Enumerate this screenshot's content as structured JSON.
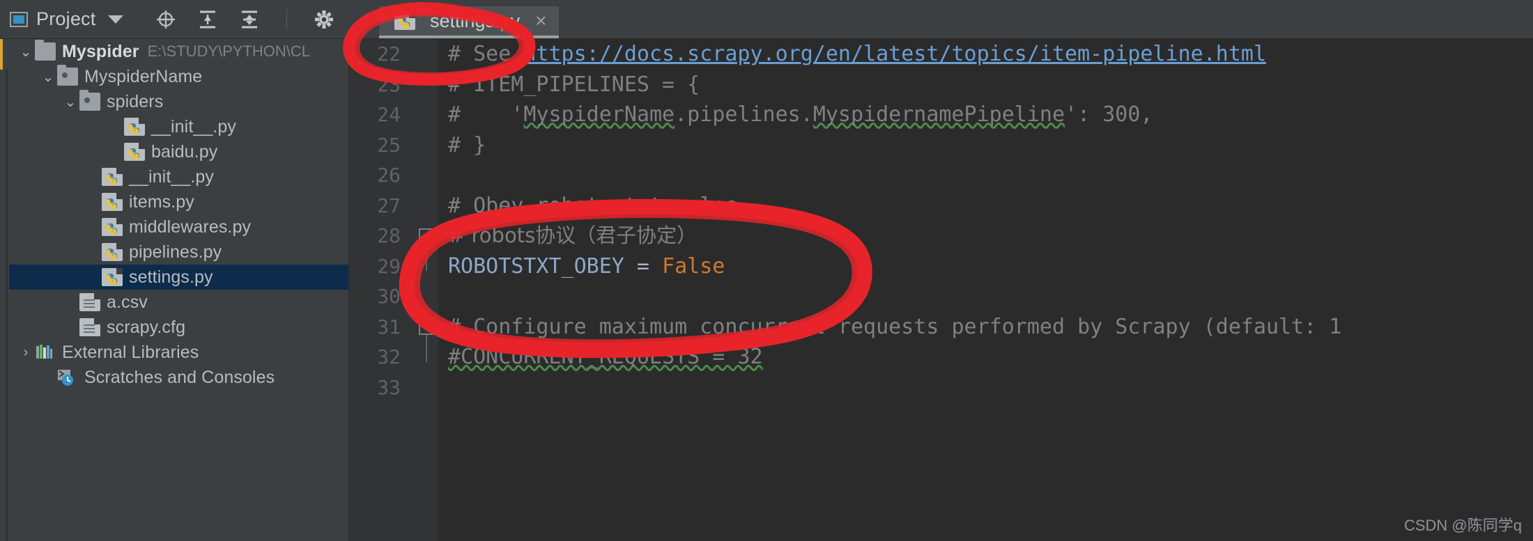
{
  "toolwindow": {
    "title": "Project",
    "icons": [
      {
        "name": "locate-icon",
        "glyph": "⊕"
      },
      {
        "name": "expand-all-icon",
        "glyph": "⇳"
      },
      {
        "name": "collapse-all-icon",
        "glyph": "⇲"
      },
      {
        "name": "settings-gear-icon",
        "glyph": "⚙"
      }
    ],
    "dropdown_caret": "▾"
  },
  "editor_tabs": [
    {
      "label": "settings.py",
      "icon": "python-file-icon",
      "close": "×",
      "active": true
    }
  ],
  "project_tree": [
    {
      "label": "Myspider",
      "path": "E:\\STUDY\\PYTHON\\CL",
      "icon": "folder-icon",
      "chevron": "⌄",
      "depth": 0,
      "bold": true,
      "selected": false
    },
    {
      "label": "MyspiderName",
      "path": "",
      "icon": "folder-dot-icon",
      "chevron": "⌄",
      "depth": 1,
      "bold": false,
      "selected": false
    },
    {
      "label": "spiders",
      "path": "",
      "icon": "folder-dot-icon",
      "chevron": "⌄",
      "depth": 2,
      "bold": false,
      "selected": false
    },
    {
      "label": "__init__.py",
      "path": "",
      "icon": "python-file-icon",
      "chevron": "",
      "depth": 4,
      "bold": false,
      "selected": false
    },
    {
      "label": "baidu.py",
      "path": "",
      "icon": "python-file-icon",
      "chevron": "",
      "depth": 4,
      "bold": false,
      "selected": false
    },
    {
      "label": "__init__.py",
      "path": "",
      "icon": "python-file-icon",
      "chevron": "",
      "depth": 3,
      "bold": false,
      "selected": false
    },
    {
      "label": "items.py",
      "path": "",
      "icon": "python-file-icon",
      "chevron": "",
      "depth": 3,
      "bold": false,
      "selected": false
    },
    {
      "label": "middlewares.py",
      "path": "",
      "icon": "python-file-icon",
      "chevron": "",
      "depth": 3,
      "bold": false,
      "selected": false
    },
    {
      "label": "pipelines.py",
      "path": "",
      "icon": "python-file-icon",
      "chevron": "",
      "depth": 3,
      "bold": false,
      "selected": false
    },
    {
      "label": "settings.py",
      "path": "",
      "icon": "python-file-icon",
      "chevron": "",
      "depth": 3,
      "bold": false,
      "selected": true
    },
    {
      "label": "a.csv",
      "path": "",
      "icon": "document-icon",
      "chevron": "",
      "depth": 2,
      "bold": false,
      "selected": false
    },
    {
      "label": "scrapy.cfg",
      "path": "",
      "icon": "document-icon",
      "chevron": "",
      "depth": 2,
      "bold": false,
      "selected": false
    },
    {
      "label": "External Libraries",
      "path": "",
      "icon": "libraries-icon",
      "chevron": "›",
      "depth": 0,
      "bold": false,
      "selected": false
    },
    {
      "label": "Scratches and Consoles",
      "path": "",
      "icon": "scratches-icon",
      "chevron": "",
      "depth": 1,
      "bold": false,
      "selected": false
    }
  ],
  "code": {
    "first_line_number": 22,
    "lines": [
      {
        "num": "22",
        "segments": [
          {
            "t": "# See ",
            "c": "cmt"
          },
          {
            "t": "https://docs.scrapy.org/en/latest/topics/item-pipeline.html",
            "c": "link"
          }
        ],
        "fold": "none"
      },
      {
        "num": "23",
        "segments": [
          {
            "t": "# ITEM_PIPELINES = {",
            "c": "cmt"
          }
        ],
        "fold": "none"
      },
      {
        "num": "24",
        "segments": [
          {
            "t": "#    '",
            "c": "cmt"
          },
          {
            "t": "MyspiderName",
            "c": "sq"
          },
          {
            "t": ".pipelines.",
            "c": "cmt"
          },
          {
            "t": "MyspidernamePipeline",
            "c": "sq"
          },
          {
            "t": "': 300,",
            "c": "cmt"
          }
        ],
        "fold": "none"
      },
      {
        "num": "25",
        "segments": [
          {
            "t": "# }",
            "c": "cmt"
          }
        ],
        "fold": "none"
      },
      {
        "num": "26",
        "segments": [
          {
            "t": "",
            "c": "cmt"
          }
        ],
        "fold": "none"
      },
      {
        "num": "27",
        "segments": [
          {
            "t": "# Obey robots.txt rules",
            "c": "cmt"
          }
        ],
        "fold": "none"
      },
      {
        "num": "28",
        "segments": [
          {
            "t": "# robots协议（君子协定）",
            "c": "cmt"
          }
        ],
        "fold": "start"
      },
      {
        "num": "29",
        "segments": [
          {
            "t": "ROBOTSTXT_OBEY",
            "c": "kw"
          },
          {
            "t": " = ",
            "c": "op"
          },
          {
            "t": "False",
            "c": "val"
          }
        ],
        "fold": "end"
      },
      {
        "num": "30",
        "segments": [
          {
            "t": "",
            "c": "cmt"
          }
        ],
        "fold": "none"
      },
      {
        "num": "31",
        "segments": [
          {
            "t": "# Configure maximum concurrent requests performed by Scrapy (default: 1",
            "c": "cmt"
          }
        ],
        "fold": "start"
      },
      {
        "num": "32",
        "segments": [
          {
            "t": "#CONCURRENT_REQUESTS = 32",
            "c": "sq"
          }
        ],
        "fold": "none"
      },
      {
        "num": "33",
        "segments": [
          {
            "t": "",
            "c": "cmt"
          }
        ],
        "fold": "none"
      }
    ]
  },
  "annotations": {
    "tab_circle": "red-ellipse-around-settings-tab",
    "code_circle": "red-ellipse-around-robotstxt-obey",
    "color": "#e8242a"
  },
  "watermark": "CSDN @陈同学q"
}
